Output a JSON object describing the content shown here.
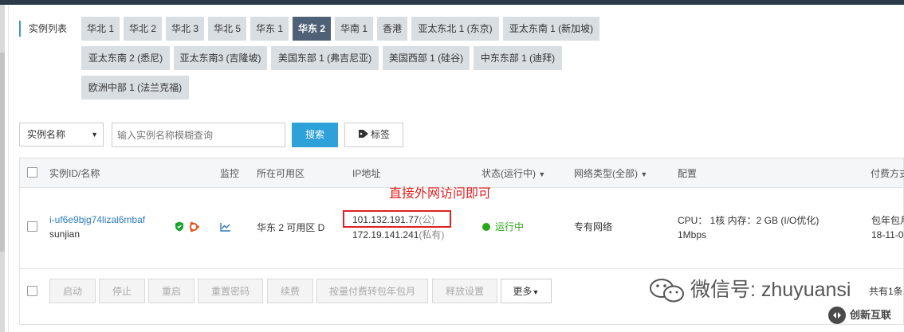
{
  "instance_list": {
    "title": "实例列表",
    "regions": [
      {
        "label": "华北 1",
        "active": false
      },
      {
        "label": "华北 2",
        "active": false
      },
      {
        "label": "华北 3",
        "active": false
      },
      {
        "label": "华北 5",
        "active": false
      },
      {
        "label": "华东 1",
        "active": false
      },
      {
        "label": "华东 2",
        "active": true
      },
      {
        "label": "华南 1",
        "active": false
      },
      {
        "label": "香港",
        "active": false
      },
      {
        "label": "亚太东北 1 (东京)",
        "active": false
      },
      {
        "label": "亚太东南 1 (新加坡)",
        "active": false
      },
      {
        "label": "亚太东南 2 (悉尼)",
        "active": false
      },
      {
        "label": "亚太东南3 (吉隆坡)",
        "active": false
      },
      {
        "label": "美国东部 1 (弗吉尼亚)",
        "active": false
      },
      {
        "label": "美国西部 1 (硅谷)",
        "active": false
      },
      {
        "label": "中东东部 1 (迪拜)",
        "active": false
      },
      {
        "label": "欧洲中部 1 (法兰克福)",
        "active": false
      }
    ]
  },
  "search": {
    "field_select": "实例名称",
    "placeholder": "输入实例名称模糊查询",
    "search_button": "搜索",
    "tag_button": "标签"
  },
  "table": {
    "headers": {
      "id_name": "实例ID/名称",
      "monitor": "监控",
      "zone": "所在可用区",
      "ip": "IP地址",
      "status": "状态(运行中)",
      "network": "网络类型(全部)",
      "config": "配置",
      "billing": "付费方式"
    },
    "row": {
      "instance_id": "i-uf6e9bjg74lizal6mbaf",
      "name": "sunjian",
      "zone": "华东 2 可用区 D",
      "public_ip": "101.132.191.77",
      "public_suffix": "(公)",
      "private_ip": "172.19.141.241",
      "private_suffix": "(私有)",
      "status": "运行中",
      "network": "专有网络",
      "config_line1": "CPU： 1核    内存：2 GB (I/O优化)",
      "config_line2": "1Mbps",
      "billing_line1": "包年包月",
      "billing_line2": "18-11-0"
    },
    "annotation": "直接外网访问即可"
  },
  "footer_actions": {
    "start": "启动",
    "stop": "停止",
    "restart": "重启",
    "reset_password": "重置密码",
    "renew": "续费",
    "convert": "按量付费转包年包月",
    "release": "释放设置",
    "more": "更多"
  },
  "pagination_text": "共有1条,",
  "watermark": {
    "text": "微信号: zhuyuansi",
    "brand": "创新互联"
  },
  "colors": {
    "active_region": "#4f6176",
    "region_bg": "#d9dee3",
    "search_button": "#2ea1d8",
    "link": "#2d7bbf",
    "running": "#2aa515",
    "highlight": "#dd2222"
  }
}
